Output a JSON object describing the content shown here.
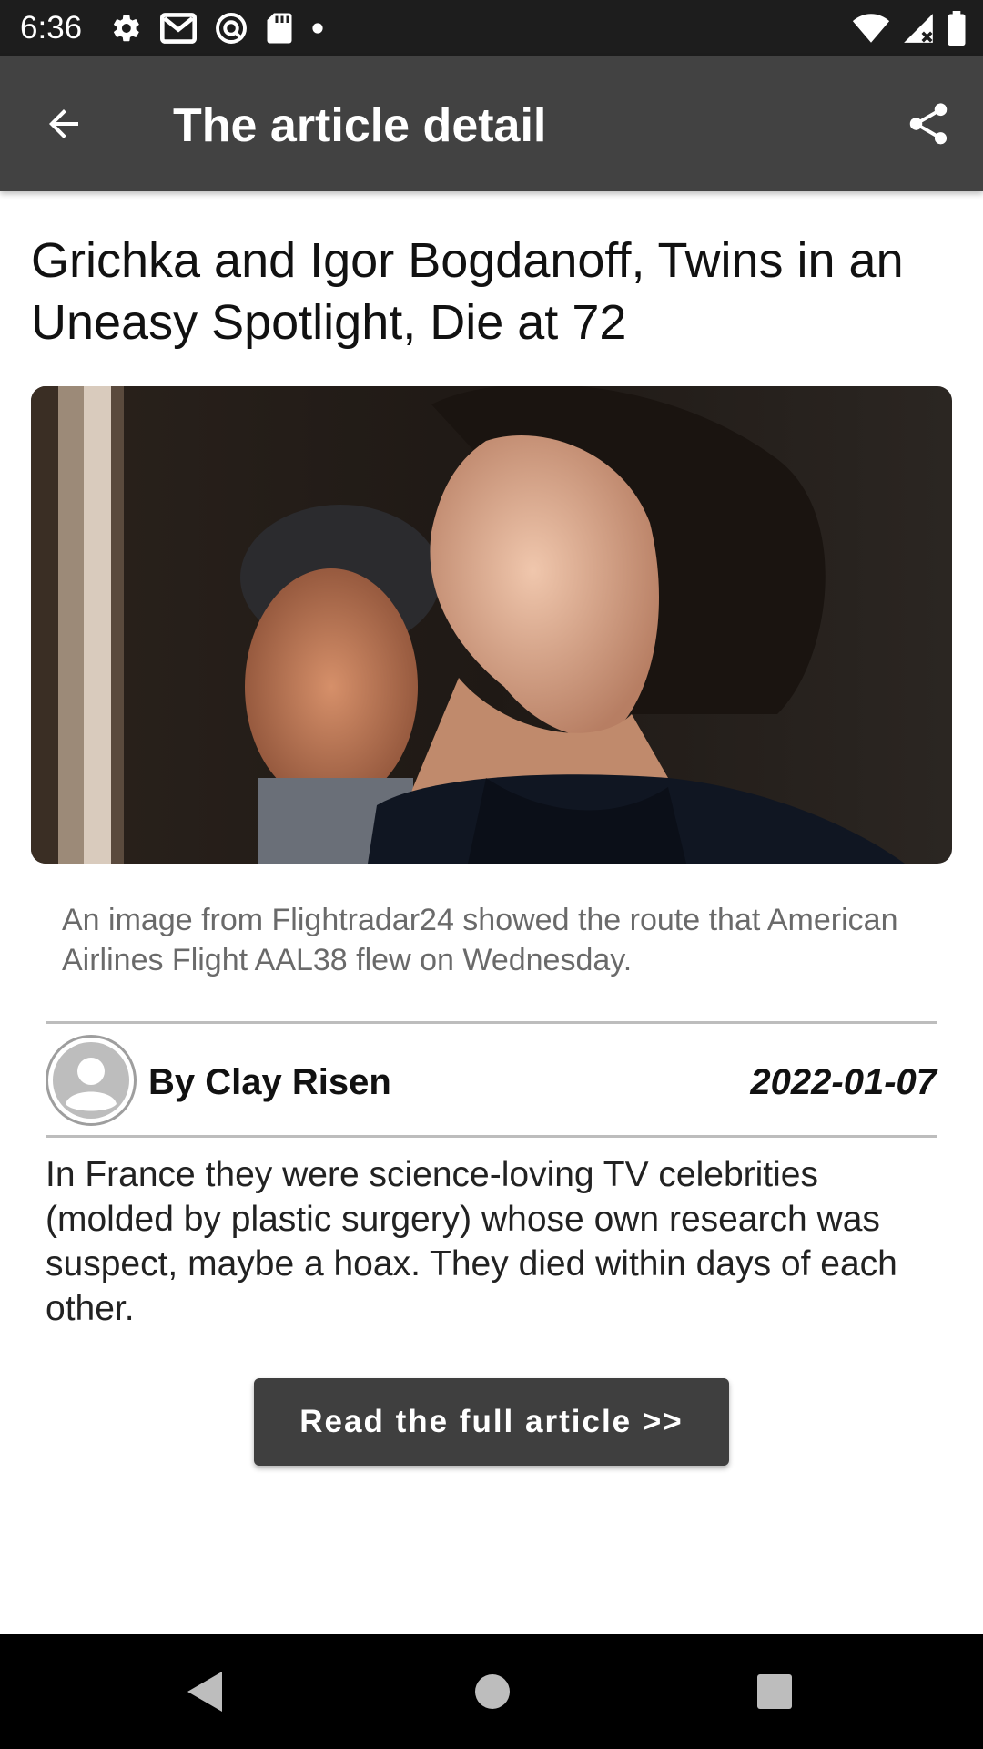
{
  "status_bar": {
    "time": "6:36",
    "left_icons": [
      "settings-icon",
      "gmail-icon",
      "vpn-icon",
      "sd-card-icon",
      "dot-icon"
    ],
    "right_icons": [
      "wifi-icon",
      "signal-icon",
      "battery-icon"
    ]
  },
  "app_bar": {
    "title": "The article detail",
    "back_icon": "arrow-back-icon",
    "share_icon": "share-icon",
    "background": "#424242"
  },
  "article": {
    "title": "Grichka and Igor Bogdanoff, Twins in an Uneasy Spotlight, Die at 72",
    "image_caption": "An image from Flightradar24 showed the route that American Airlines Flight AAL38 flew on Wednesday.",
    "author": "By Clay Risen",
    "date": "2022-01-07",
    "summary": "In France they were science-loving TV celebrities (molded by plastic surgery) whose own research was suspect, maybe a hoax. They died within days of each other.",
    "read_button_label": "Read the full article >>"
  },
  "nav_bar": {
    "buttons": [
      "back-triangle-icon",
      "home-circle-icon",
      "recents-square-icon"
    ]
  }
}
